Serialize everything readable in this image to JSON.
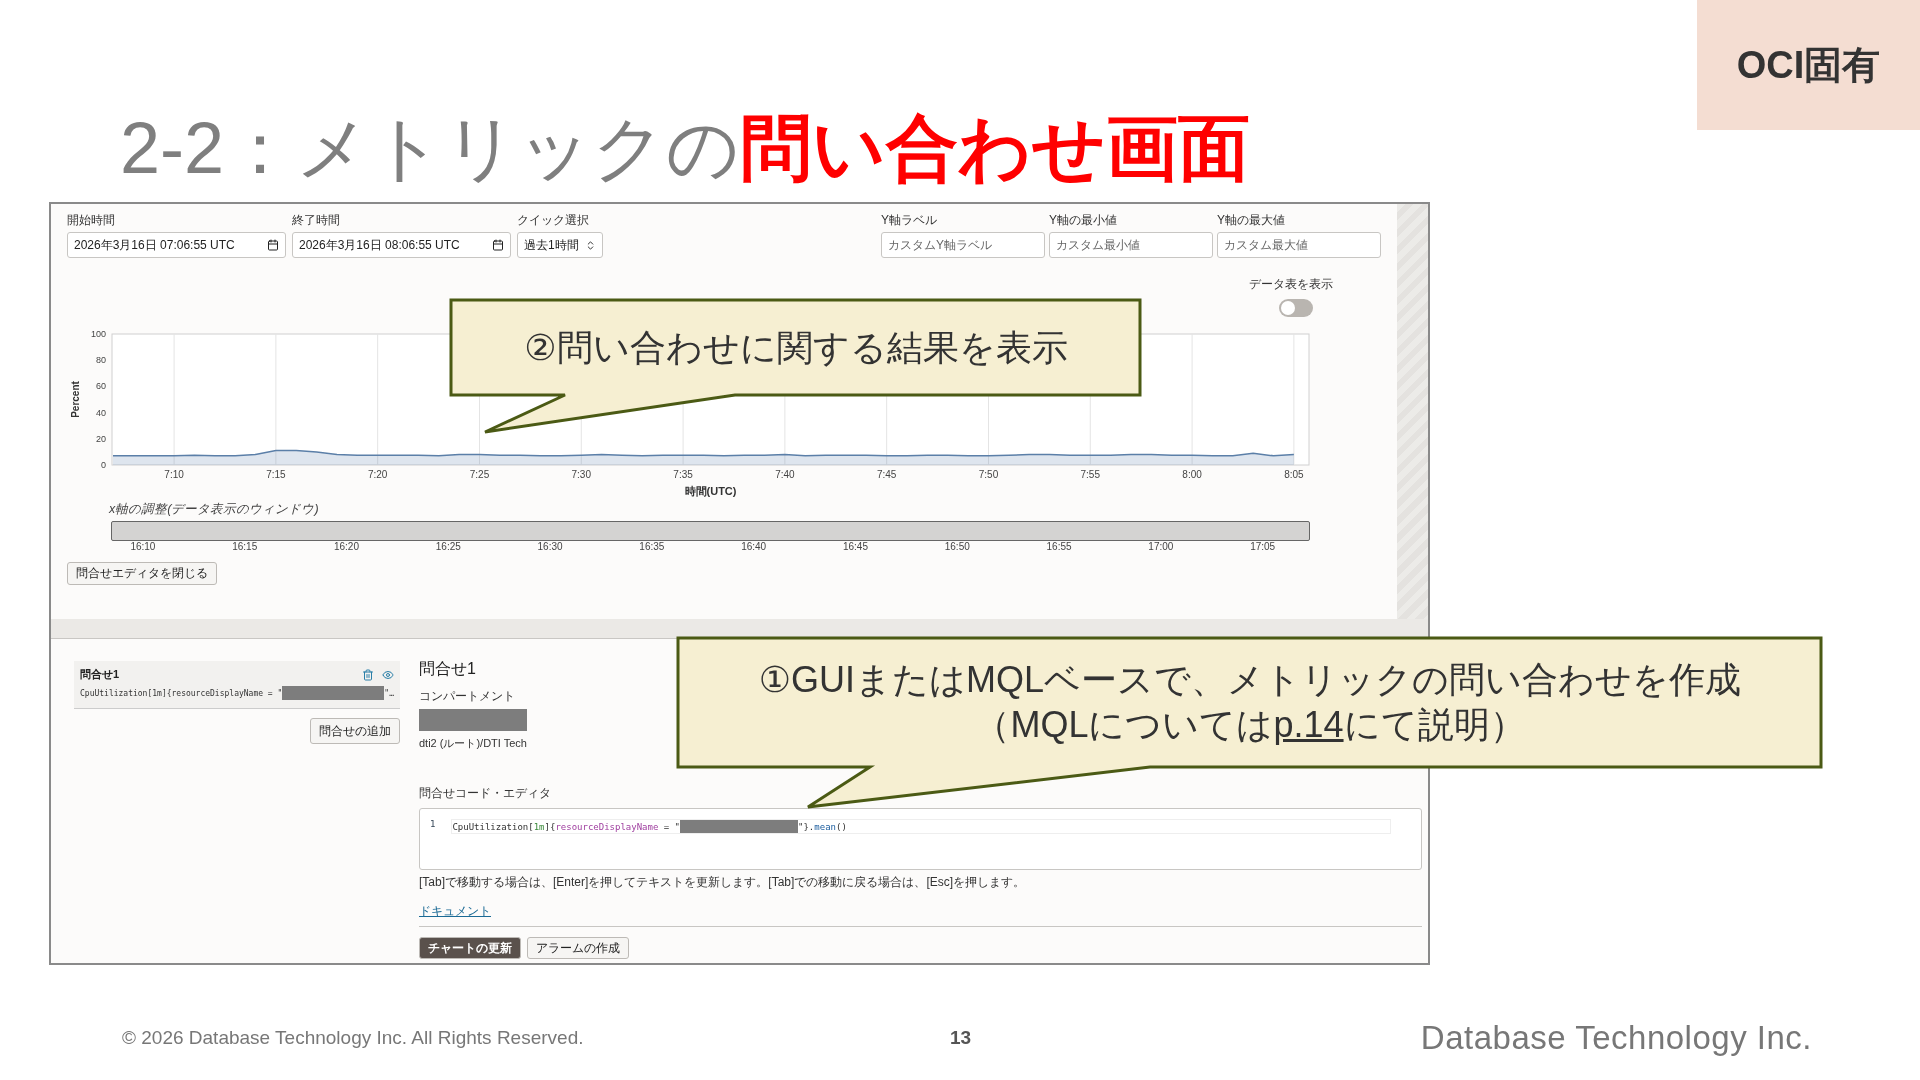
{
  "tag": "OCI固有",
  "title": "2-2：メトリックの**問い合わせ画面**",
  "query_panel": {
    "fields": [
      {
        "label": "開始時間",
        "value": "2026年3月16日 07:06:55 UTC",
        "kind": "date"
      },
      {
        "label": "終了時間",
        "value": "2026年3月16日 08:06:55 UTC",
        "kind": "date"
      },
      {
        "label": "クイック選択",
        "value": "過去1時間",
        "kind": "select"
      }
    ],
    "axis_fields": [
      {
        "label": "Y軸ラベル",
        "placeholder": "カスタムY軸ラベル"
      },
      {
        "label": "Y軸の最小値",
        "placeholder": "カスタム最小値"
      },
      {
        "label": "Y軸の最大値",
        "placeholder": "カスタム最大値"
      }
    ],
    "show_data_table": {
      "label": "データ表を表示",
      "on": false
    },
    "chart_data": {
      "type": "area",
      "xlabel": "時間(UTC)",
      "ylabel": "Percent",
      "categories": [
        null,
        null,
        null,
        "7:10",
        null,
        null,
        null,
        null,
        "7:15",
        null,
        null,
        null,
        null,
        "7:20",
        null,
        null,
        null,
        null,
        "7:25",
        null,
        null,
        null,
        null,
        "7:30",
        null,
        null,
        null,
        null,
        "7:35",
        null,
        null,
        null,
        null,
        "7:40",
        null,
        null,
        null,
        null,
        "7:45",
        null,
        null,
        null,
        null,
        "7:50",
        null,
        null,
        null,
        null,
        "7:55",
        null,
        null,
        null,
        null,
        "8:00",
        null,
        null,
        null,
        null,
        "8:05"
      ],
      "series": [
        {
          "color": "#5b7fa8",
          "values": [
            7,
            7,
            7,
            7,
            7.5,
            7,
            7,
            8,
            11,
            11,
            10,
            8,
            7.5,
            7.5,
            7.5,
            7.5,
            7,
            8,
            8,
            7.5,
            7.5,
            7,
            7,
            7.5,
            8,
            7.5,
            7,
            7.5,
            7.5,
            7.5,
            7,
            7.5,
            7.5,
            8,
            7,
            7.5,
            7.5,
            7.5,
            7,
            7,
            7.5,
            7.5,
            7,
            7,
            7.5,
            8,
            8,
            7.5,
            7.5,
            7.5,
            8,
            8,
            7.5,
            7.5,
            7,
            7,
            9,
            7,
            8
          ]
        }
      ],
      "ylim": [
        0,
        100
      ],
      "grid": true,
      "yticks": [
        0,
        20,
        40,
        60,
        80,
        100
      ]
    },
    "range_slider": {
      "label": "x軸の調整(データ表示のウィンドウ)",
      "ticks": [
        "16:10",
        "16:15",
        "16:20",
        "16:25",
        "16:30",
        "16:35",
        "16:40",
        "16:45",
        "16:50",
        "16:55",
        "17:00",
        "17:05"
      ]
    },
    "close_button": "問合せエディタを閉じる"
  },
  "editor": {
    "queries": [
      {
        "title": "問合せ1",
        "summary": [
          {
            "kind": "text",
            "text": "CpuUtilization[1m]{resourceDisplayName = \""
          },
          {
            "kind": "redacted"
          },
          {
            "kind": "text",
            "text": "\"…"
          }
        ]
      }
    ],
    "add_button": "問合せの追加",
    "title": "問合せ1",
    "compartment": {
      "label": "コンパートメント",
      "path": "dti2 (ルート)/DTI Tech"
    },
    "code_editor": {
      "label": "問合せコード・エディタ",
      "lines": [
        {
          "number": "1",
          "tokens": [
            {
              "kind": "plain",
              "text": "CpuUtilization["
            },
            {
              "kind": "number",
              "text": "1m"
            },
            {
              "kind": "plain",
              "text": "]{"
            },
            {
              "kind": "attr",
              "text": "resourceDisplayName"
            },
            {
              "kind": "plain",
              "text": " = \""
            },
            {
              "kind": "redacted"
            },
            {
              "kind": "plain",
              "text": "\"}."
            },
            {
              "kind": "method",
              "text": "mean"
            },
            {
              "kind": "plain",
              "text": "()"
            }
          ]
        }
      ]
    },
    "help": "[Tab]で移動する場合は、[Enter]を押してテキストを更新します。[Tab]での移動に戻る場合は、[Esc]を押します。",
    "doc_link": "ドキュメント",
    "buttons": [
      {
        "label": "チャートの更新",
        "kind": "primary"
      },
      {
        "label": "アラームの作成",
        "kind": "secondary"
      }
    ]
  },
  "callouts": [
    {
      "lines": [
        {
          "text": "②問い合わせに関する結果を表示"
        }
      ]
    },
    {
      "lines": [
        {
          "text": "①GUIまたはMQLベースで、メトリックの問い合わせを作成"
        },
        {
          "text": "（MQLについては",
          "link": "p.14",
          "after": "にて説明）"
        }
      ]
    }
  ],
  "footer": {
    "copyright": "© 2026 Database Technology Inc. All Rights Reserved.",
    "page": "13",
    "logo": "Database Technology Inc."
  }
}
